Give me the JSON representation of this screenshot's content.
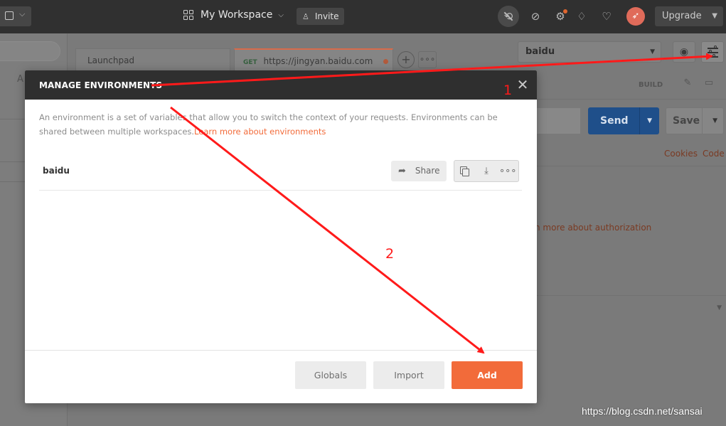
{
  "topbar": {
    "workspace_label": "My Workspace",
    "invite_label": "Invite",
    "upgrade_label": "Upgrade",
    "icons": [
      "new-icon",
      "grid-icon",
      "person-add-icon",
      "sync-off-icon",
      "satellite-icon",
      "gear-icon",
      "bell-icon",
      "heart-icon",
      "rocket-icon"
    ]
  },
  "background": {
    "sidebar_letter": "A",
    "tabs": [
      {
        "label": "Launchpad"
      },
      {
        "method": "GET",
        "label": "https://jingyan.baidu.com"
      }
    ],
    "environment_selected": "baidu",
    "build_label": "BUILD",
    "send_label": "Send",
    "save_label": "Save",
    "cookies_label": "Cookies",
    "code_label": "Code",
    "auth_link": "n more about authorization"
  },
  "modal": {
    "title": "MANAGE ENVIRONMENTS",
    "description": "An environment is a set of variables that allow you to switch the context of your requests. Environments can be shared between multiple workspaces.",
    "learn_more": "Learn more about environments",
    "environments": [
      {
        "name": "baidu",
        "share_label": "Share"
      }
    ],
    "buttons": {
      "globals": "Globals",
      "import": "Import",
      "add": "Add"
    }
  },
  "annotations": {
    "step1": "1",
    "step2": "2",
    "arrow_color": "#ff1a1a"
  },
  "watermark": "https://blog.csdn.net/sansai",
  "colors": {
    "accent": "#f26b3a",
    "topbar": "#303030",
    "send": "#1f4f8a"
  }
}
